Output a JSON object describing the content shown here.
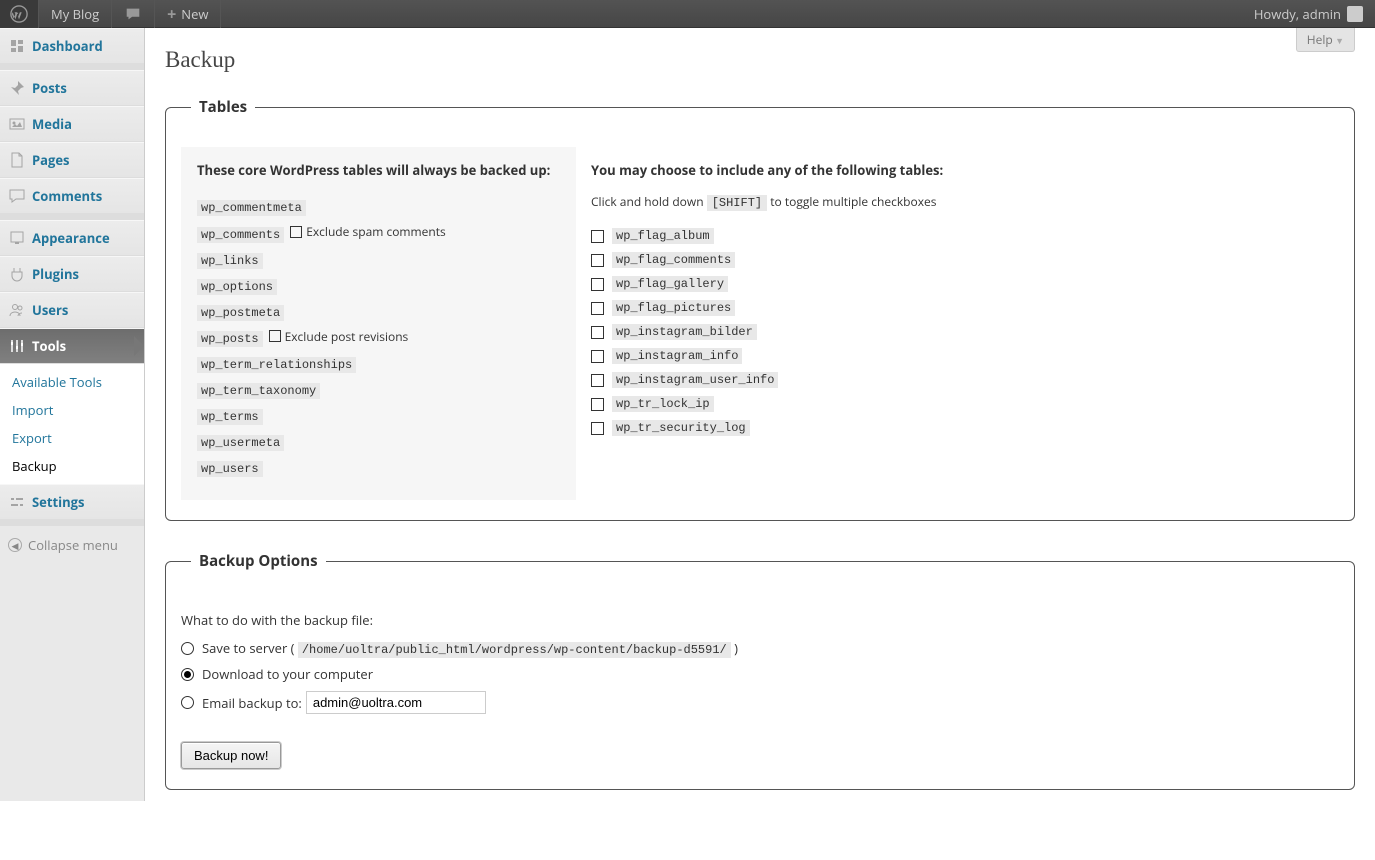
{
  "adminbar": {
    "site_name": "My Blog",
    "new_label": "New",
    "howdy_prefix": "Howdy, ",
    "user": "admin"
  },
  "help_label": "Help",
  "menu": {
    "items": [
      {
        "id": "dashboard",
        "label": "Dashboard"
      },
      {
        "id": "posts",
        "label": "Posts"
      },
      {
        "id": "media",
        "label": "Media"
      },
      {
        "id": "pages",
        "label": "Pages"
      },
      {
        "id": "comments",
        "label": "Comments"
      },
      {
        "id": "appearance",
        "label": "Appearance"
      },
      {
        "id": "plugins",
        "label": "Plugins"
      },
      {
        "id": "users",
        "label": "Users"
      },
      {
        "id": "tools",
        "label": "Tools"
      },
      {
        "id": "settings",
        "label": "Settings"
      }
    ],
    "tools_submenu": [
      "Available Tools",
      "Import",
      "Export",
      "Backup"
    ],
    "collapse": "Collapse menu"
  },
  "page": {
    "title": "Backup",
    "tables_legend": "Tables",
    "core_heading": "These core WordPress tables will always be backed up:",
    "core_tables": [
      "wp_commentmeta",
      "wp_comments",
      "wp_links",
      "wp_options",
      "wp_postmeta",
      "wp_posts",
      "wp_term_relationships",
      "wp_term_taxonomy",
      "wp_terms",
      "wp_usermeta",
      "wp_users"
    ],
    "exclude_spam": "Exclude spam comments",
    "exclude_revisions": "Exclude post revisions",
    "optional_heading": "You may choose to include any of the following tables:",
    "hint_pre": "Click and hold down ",
    "hint_key": "[SHIFT]",
    "hint_post": " to toggle multiple checkboxes",
    "optional_tables": [
      "wp_flag_album",
      "wp_flag_comments",
      "wp_flag_gallery",
      "wp_flag_pictures",
      "wp_instagram_bilder",
      "wp_instagram_info",
      "wp_instagram_user_info",
      "wp_tr_lock_ip",
      "wp_tr_security_log"
    ],
    "options_legend": "Backup Options",
    "what_to_do": "What to do with the backup file:",
    "save_server_pre": "Save to server ( ",
    "save_path": "/home/uoltra/public_html/wordpress/wp-content/backup-d5591/",
    "save_server_post": " )",
    "download_label": "Download to your computer",
    "email_label": "Email backup to:",
    "email_value": "admin@uoltra.com",
    "backup_button": "Backup now!"
  }
}
